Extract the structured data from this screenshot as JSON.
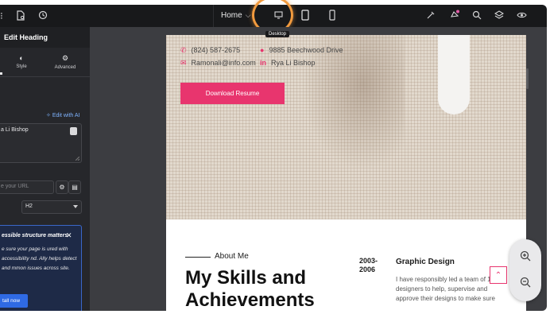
{
  "topbar": {
    "page_label": "Home",
    "device_tooltip": "Desktop",
    "icons": [
      "page-settings-icon",
      "history-icon",
      "desktop-icon",
      "tablet-icon",
      "mobile-icon",
      "magic-icon",
      "notifications-icon",
      "search-icon",
      "layers-icon",
      "preview-icon"
    ]
  },
  "panel": {
    "title": "Edit Heading",
    "tabs": [
      {
        "label": "Style",
        "icon": "style-icon"
      },
      {
        "label": "Advanced",
        "icon": "gear-icon"
      }
    ],
    "edit_ai_label": "Edit with AI",
    "title_value": "a Li Bishop",
    "link_placeholder": "e your URL",
    "html_tag_value": "H2",
    "notice": {
      "title": "essible structure matters",
      "body": "e sure your page is ured with accessibility nd. Ally helps detect and mmon issues across site.",
      "button_label": "tall now"
    }
  },
  "preview": {
    "contacts": [
      {
        "icon": "phone-icon",
        "text": "(824) 587-2675"
      },
      {
        "icon": "map-pin-icon",
        "text": "9885 Beechwood Drive"
      },
      {
        "icon": "mail-icon",
        "text": "Ramonali@info.com"
      },
      {
        "icon": "linkedin-icon",
        "text": "Rya Li Bishop"
      }
    ],
    "download_label": "Download Resume",
    "about_label": "About Me",
    "skills_heading": "My Skills and Achievements",
    "timeline": {
      "years": "2003-\n2006",
      "job_title": "Graphic Design",
      "description": "I have responsibly led a team of 12 designers to help, supervise and approve their designs to make sure"
    }
  },
  "colors": {
    "accent": "#e8356e",
    "highlight_ring": "#f19a3e",
    "panel_bg": "#26272b",
    "notice_button": "#2f6ae4"
  }
}
